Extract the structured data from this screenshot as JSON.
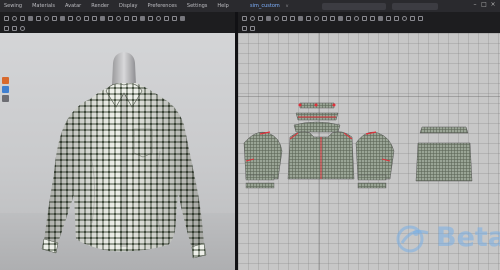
{
  "menu": {
    "items": [
      "Sewing",
      "Materials",
      "Avatar",
      "Render",
      "Display",
      "Preferences",
      "Settings",
      "Help"
    ]
  },
  "header": {
    "simulation_label": "sim_custom",
    "version_label": "v"
  },
  "colors": {
    "seam_highlight": "#e0303a",
    "pattern_fabric": "#8e9a88",
    "accent": "#4d8fe0"
  },
  "watermark": {
    "text": "Beta"
  }
}
